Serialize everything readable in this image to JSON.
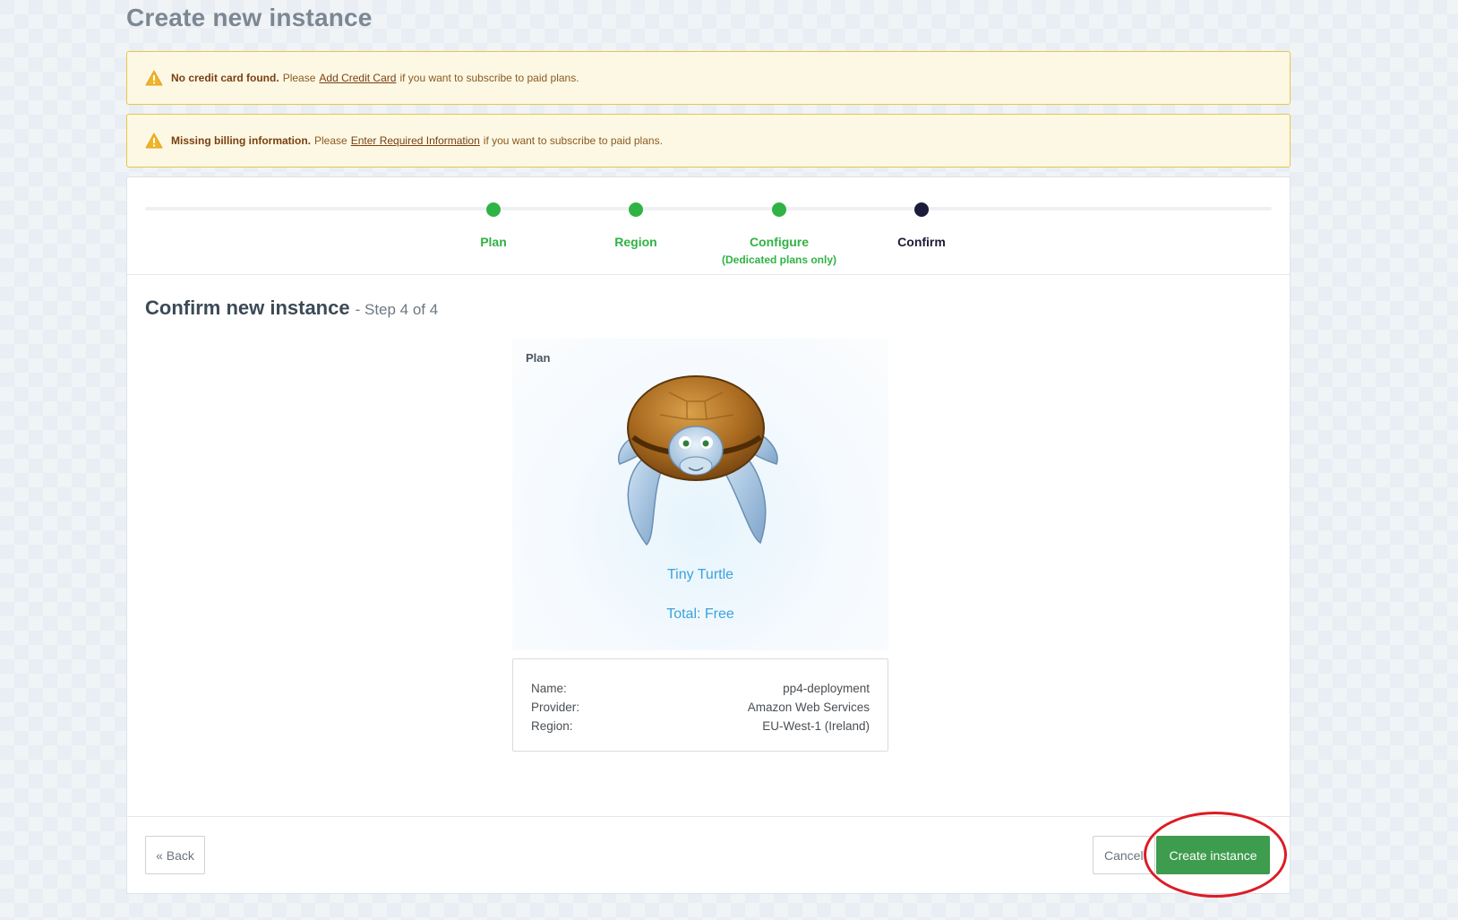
{
  "page": {
    "title": "Create new instance"
  },
  "alerts": [
    {
      "bold": "No credit card found.",
      "pre": "Please",
      "link": "Add Credit Card",
      "post": "if you want to subscribe to paid plans."
    },
    {
      "bold": "Missing billing information.",
      "pre": "Please",
      "link": "Enter Required Information",
      "post": "if you want to subscribe to paid plans."
    }
  ],
  "steps": [
    {
      "label": "Plan",
      "sub": "",
      "state": "done"
    },
    {
      "label": "Region",
      "sub": "",
      "state": "done"
    },
    {
      "label": "Configure",
      "sub": "(Dedicated plans only)",
      "state": "done"
    },
    {
      "label": "Confirm",
      "sub": "",
      "state": "current"
    }
  ],
  "confirm": {
    "title": "Confirm new instance",
    "subtitle": "- Step 4 of 4"
  },
  "plan": {
    "label": "Plan",
    "image_icon": "turtle-mascot",
    "name": "Tiny Turtle",
    "total": "Total: Free"
  },
  "details": {
    "name_label": "Name:",
    "name_value": "pp4-deployment",
    "provider_label": "Provider:",
    "provider_value": "Amazon Web Services",
    "region_label": "Region:",
    "region_value": "EU-West-1 (Ireland)"
  },
  "footer": {
    "back_label": "« Back",
    "cancel_label": "Cancel",
    "create_label": "Create instance"
  },
  "colors": {
    "step_done": "#2fb344",
    "step_current": "#1c1b3a",
    "primary_button": "#3d9c4d",
    "plan_text": "#3aa3dd",
    "annotation_ring": "#dd1b24"
  }
}
